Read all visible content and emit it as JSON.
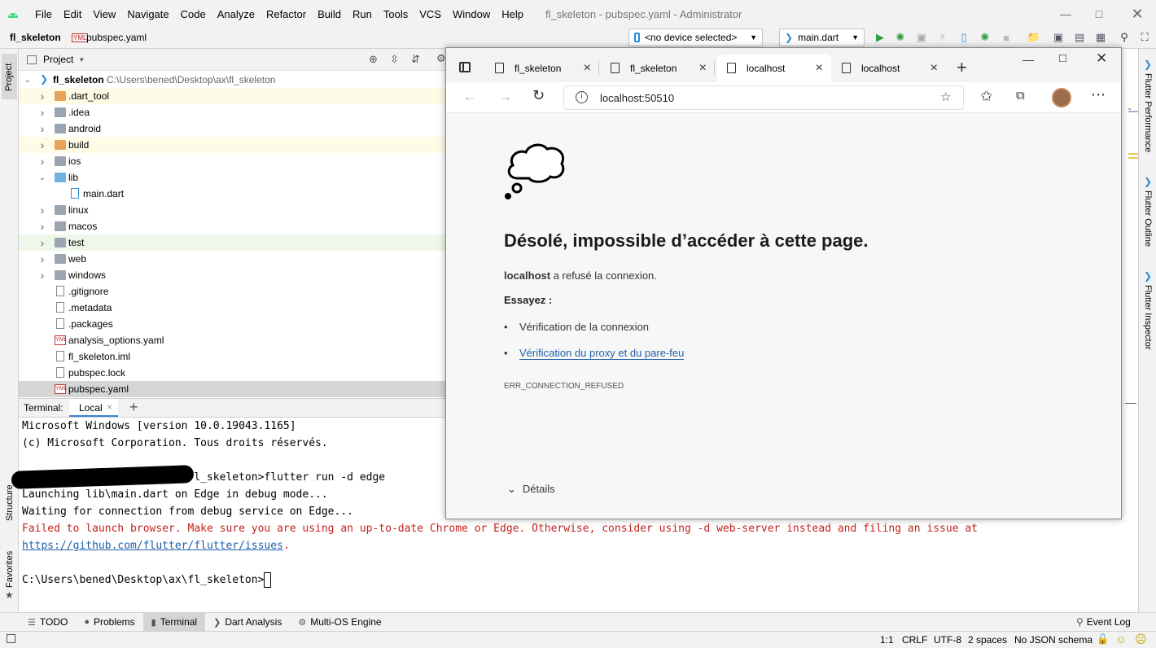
{
  "ide": {
    "menu": [
      "File",
      "Edit",
      "View",
      "Navigate",
      "Code",
      "Analyze",
      "Refactor",
      "Build",
      "Run",
      "Tools",
      "VCS",
      "Window",
      "Help"
    ],
    "window_title": "fl_skeleton - pubspec.yaml - Administrator",
    "breadcrumb": {
      "project": "fl_skeleton",
      "file": "pubspec.yaml",
      "file_icon_text": "YML"
    },
    "device_selector": "<no device selected>",
    "run_config": "main.dart",
    "project_panel": {
      "title": "Project",
      "root": {
        "name": "fl_skeleton",
        "path": "C:\\Users\\bened\\Desktop\\ax\\fl_skeleton"
      },
      "items": [
        {
          "name": ".dart_tool",
          "kind": "folder-orange",
          "expandable": true,
          "depth": 1,
          "bg": "#fefbe6"
        },
        {
          "name": ".idea",
          "kind": "folder",
          "expandable": true,
          "depth": 1,
          "bg": "#ffffff"
        },
        {
          "name": "android",
          "kind": "folder",
          "expandable": true,
          "depth": 1,
          "bg": "#ffffff"
        },
        {
          "name": "build",
          "kind": "folder-orange",
          "expandable": true,
          "depth": 1,
          "bg": "#fefbe6"
        },
        {
          "name": "ios",
          "kind": "folder",
          "expandable": true,
          "depth": 1,
          "bg": "#ffffff"
        },
        {
          "name": "lib",
          "kind": "folder-blue",
          "expandable": true,
          "expanded": true,
          "depth": 1,
          "bg": "#ffffff"
        },
        {
          "name": "main.dart",
          "kind": "dart",
          "expandable": false,
          "depth": 2,
          "bg": "#ffffff"
        },
        {
          "name": "linux",
          "kind": "folder",
          "expandable": true,
          "depth": 1,
          "bg": "#ffffff"
        },
        {
          "name": "macos",
          "kind": "folder",
          "expandable": true,
          "depth": 1,
          "bg": "#ffffff"
        },
        {
          "name": "test",
          "kind": "folder-green",
          "expandable": true,
          "depth": 1,
          "bg": "#eff7ea"
        },
        {
          "name": "web",
          "kind": "folder",
          "expandable": true,
          "depth": 1,
          "bg": "#ffffff"
        },
        {
          "name": "windows",
          "kind": "folder",
          "expandable": true,
          "depth": 1,
          "bg": "#ffffff"
        },
        {
          "name": ".gitignore",
          "kind": "file",
          "expandable": false,
          "depth": 1,
          "bg": "#ffffff"
        },
        {
          "name": ".metadata",
          "kind": "file",
          "expandable": false,
          "depth": 1,
          "bg": "#ffffff"
        },
        {
          "name": ".packages",
          "kind": "file",
          "expandable": false,
          "depth": 1,
          "bg": "#ffffff"
        },
        {
          "name": "analysis_options.yaml",
          "kind": "yaml",
          "expandable": false,
          "depth": 1,
          "bg": "#ffffff"
        },
        {
          "name": "fl_skeleton.iml",
          "kind": "file",
          "expandable": false,
          "depth": 1,
          "bg": "#ffffff"
        },
        {
          "name": "pubspec.lock",
          "kind": "file",
          "expandable": false,
          "depth": 1,
          "bg": "#ffffff"
        },
        {
          "name": "pubspec.yaml",
          "kind": "yaml",
          "expandable": false,
          "depth": 1,
          "bg": "#d5d5d5"
        }
      ]
    },
    "left_strip": {
      "project": "Project",
      "structure": "Structure",
      "favorites": "Favorites"
    },
    "right_strip": {
      "performance": "Flutter Performance",
      "outline": "Flutter Outline",
      "inspector": "Flutter Inspector"
    },
    "terminal": {
      "label": "Terminal:",
      "tab": "Local",
      "lines": [
        {
          "text": "Microsoft Windows [version 10.0.19043.1165]",
          "color": "#000000"
        },
        {
          "text": "(c) Microsoft Corporation. Tous droits réservés.",
          "color": "#000000"
        },
        {
          "text": "",
          "color": "#000000"
        },
        {
          "text": "C:\\Users\\bened\\Desktop\\ax\\fl_skeleton>flutter run -d edge",
          "color": "#000000"
        },
        {
          "text": "Launching lib\\main.dart on Edge in debug mode...",
          "color": "#000000"
        },
        {
          "text": "Waiting for connection from debug service on Edge...",
          "color": "#000000"
        },
        {
          "text": "Failed to launch browser. Make sure you are using an up-to-date Chrome or Edge. Otherwise, consider using -d web-server instead and filing an issue at",
          "color": "#c4221b"
        },
        {
          "text": "https://github.com/flutter/flutter/issues",
          "color": "#1f5fa9",
          "link": true,
          "suffix": "."
        },
        {
          "text": "",
          "color": "#000000"
        },
        {
          "text": "C:\\Users\\bened\\Desktop\\ax\\fl_skeleton>",
          "color": "#000000",
          "cursor": true
        }
      ]
    },
    "tool_windows": [
      "TODO",
      "Problems",
      "Terminal",
      "Dart Analysis",
      "Multi-OS Engine"
    ],
    "tool_windows_active": "Terminal",
    "event_log": "Event Log",
    "status": {
      "position": "1:1",
      "line_sep": "CRLF",
      "encoding": "UTF-8",
      "indent": "2 spaces",
      "schema": "No JSON schema"
    }
  },
  "browser": {
    "tabs": [
      {
        "title": "fl_skeleton",
        "active": false
      },
      {
        "title": "fl_skeleton",
        "active": false
      },
      {
        "title": "localhost",
        "active": true
      },
      {
        "title": "localhost",
        "active": false
      }
    ],
    "url": "localhost:50510",
    "error": {
      "heading": "Désolé, impossible d’accéder à cette page.",
      "host": "localhost",
      "host_suffix": " a refusé la connexion.",
      "try_label": "Essayez :",
      "suggestions": [
        "Vérification de la connexion",
        "Vérification du proxy et du pare-feu"
      ],
      "code": "ERR_CONNECTION_REFUSED",
      "details": "Détails"
    }
  },
  "colors": {
    "accent": "#1f5fa9",
    "error_red": "#c4221b",
    "run_green": "#2f9e44"
  }
}
